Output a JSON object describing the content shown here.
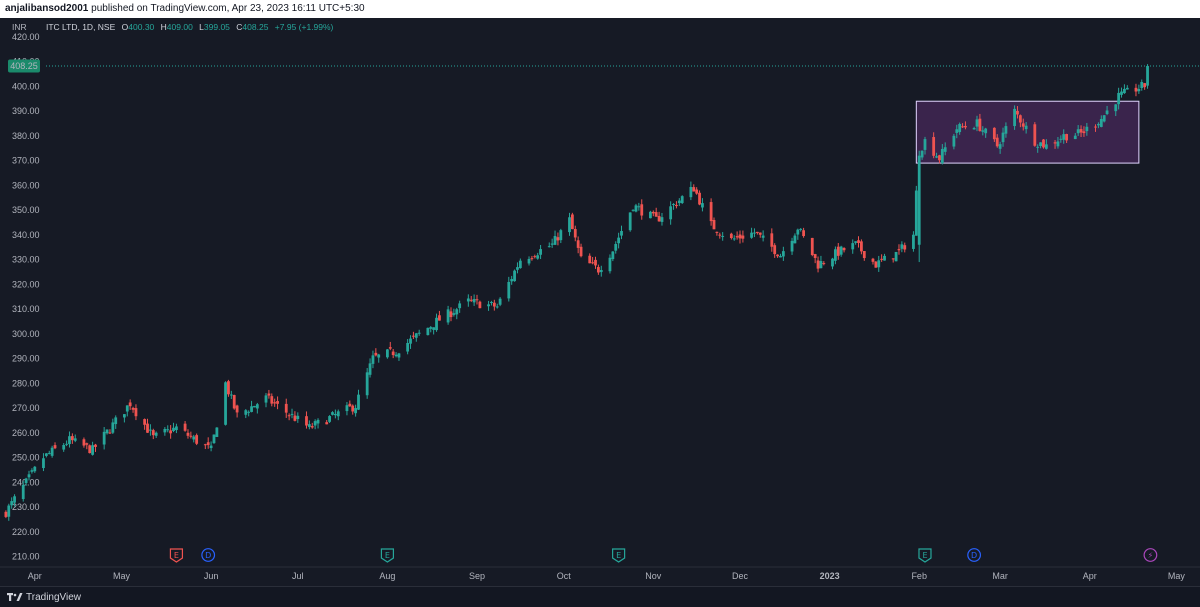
{
  "header": {
    "author": "anjalibansod2001",
    "published_text": "published on TradingView.com, Apr 23, 2023 16:11 UTC+5:30"
  },
  "legend": {
    "symbol": "ITC LTD, 1D, NSE",
    "o_label": "O",
    "o_value": "400.30",
    "h_label": "H",
    "h_value": "409.00",
    "l_label": "L",
    "l_value": "399.05",
    "c_label": "C",
    "c_value": "408.25",
    "change": "+7.95 (+1.99%)",
    "currency": "INR"
  },
  "footer": {
    "brand": "TradingView"
  },
  "colors": {
    "up": "#26a69a",
    "down": "#ef5350",
    "background": "#161a25",
    "box_fill": "#5a2d6e",
    "box_border": "#e0d5ff",
    "price_tag": "#1b8a6b"
  },
  "chart_data": {
    "type": "candlestick",
    "title": "ITC LTD, 1D, NSE",
    "ylabel": "INR",
    "ylim": [
      209,
      424
    ],
    "yticks": [
      "420.00",
      "410.00",
      "400.00",
      "390.00",
      "380.00",
      "370.00",
      "360.00",
      "350.00",
      "340.00",
      "330.00",
      "320.00",
      "310.00",
      "300.00",
      "290.00",
      "280.00",
      "270.00",
      "260.00",
      "250.00",
      "240.00",
      "230.00",
      "220.00",
      "210.00"
    ],
    "x_start": "2022-03-21",
    "x_end": "2023-05-05",
    "xticks": [
      {
        "label": "Apr",
        "date": "2022-04-01"
      },
      {
        "label": "May",
        "date": "2022-05-01"
      },
      {
        "label": "Jun",
        "date": "2022-06-01"
      },
      {
        "label": "Jul",
        "date": "2022-07-01"
      },
      {
        "label": "Aug",
        "date": "2022-08-01"
      },
      {
        "label": "Sep",
        "date": "2022-09-01"
      },
      {
        "label": "Oct",
        "date": "2022-10-01"
      },
      {
        "label": "Nov",
        "date": "2022-11-01"
      },
      {
        "label": "Dec",
        "date": "2022-12-01"
      },
      {
        "label": "2023",
        "date": "2023-01-01"
      },
      {
        "label": "Feb",
        "date": "2023-02-01"
      },
      {
        "label": "Mar",
        "date": "2023-03-01"
      },
      {
        "label": "Apr",
        "date": "2023-04-01"
      },
      {
        "label": "May",
        "date": "2023-05-01"
      }
    ],
    "last_price": "408.25",
    "last_price_value": 408.25,
    "anchors": [
      {
        "date": "2022-03-22",
        "close": 228
      },
      {
        "date": "2022-04-04",
        "close": 250
      },
      {
        "date": "2022-04-13",
        "close": 257
      },
      {
        "date": "2022-04-21",
        "close": 253
      },
      {
        "date": "2022-05-04",
        "close": 272
      },
      {
        "date": "2022-05-12",
        "close": 258
      },
      {
        "date": "2022-05-20",
        "close": 262
      },
      {
        "date": "2022-06-01",
        "close": 253
      },
      {
        "date": "2022-06-06",
        "close": 280
      },
      {
        "date": "2022-06-10",
        "close": 267
      },
      {
        "date": "2022-06-20",
        "close": 274
      },
      {
        "date": "2022-07-05",
        "close": 262
      },
      {
        "date": "2022-07-12",
        "close": 266
      },
      {
        "date": "2022-07-21",
        "close": 271
      },
      {
        "date": "2022-07-27",
        "close": 290
      },
      {
        "date": "2022-08-04",
        "close": 293
      },
      {
        "date": "2022-08-18",
        "close": 305
      },
      {
        "date": "2022-08-29",
        "close": 313
      },
      {
        "date": "2022-09-08",
        "close": 311
      },
      {
        "date": "2022-09-16",
        "close": 330
      },
      {
        "date": "2022-09-27",
        "close": 336
      },
      {
        "date": "2022-10-03",
        "close": 346
      },
      {
        "date": "2022-10-07",
        "close": 330
      },
      {
        "date": "2022-10-13",
        "close": 326
      },
      {
        "date": "2022-10-18",
        "close": 334
      },
      {
        "date": "2022-10-25",
        "close": 352
      },
      {
        "date": "2022-11-02",
        "close": 346
      },
      {
        "date": "2022-11-15",
        "close": 359
      },
      {
        "date": "2022-11-21",
        "close": 344
      },
      {
        "date": "2022-11-28",
        "close": 338
      },
      {
        "date": "2022-12-06",
        "close": 341
      },
      {
        "date": "2022-12-15",
        "close": 332
      },
      {
        "date": "2022-12-21",
        "close": 343
      },
      {
        "date": "2022-12-28",
        "close": 328
      },
      {
        "date": "2023-01-04",
        "close": 333
      },
      {
        "date": "2023-01-10",
        "close": 336
      },
      {
        "date": "2023-01-17",
        "close": 328
      },
      {
        "date": "2023-01-25",
        "close": 333
      },
      {
        "date": "2023-01-30",
        "close": 340
      },
      {
        "date": "2023-02-01",
        "close": 374
      },
      {
        "date": "2023-02-03",
        "close": 378
      },
      {
        "date": "2023-02-08",
        "close": 371
      },
      {
        "date": "2023-02-14",
        "close": 383
      },
      {
        "date": "2023-02-21",
        "close": 385
      },
      {
        "date": "2023-02-28",
        "close": 376
      },
      {
        "date": "2023-03-06",
        "close": 390
      },
      {
        "date": "2023-03-13",
        "close": 378
      },
      {
        "date": "2023-03-17",
        "close": 376
      },
      {
        "date": "2023-03-23",
        "close": 380
      },
      {
        "date": "2023-03-29",
        "close": 381
      },
      {
        "date": "2023-04-05",
        "close": 387
      },
      {
        "date": "2023-04-11",
        "close": 396
      },
      {
        "date": "2023-04-17",
        "close": 399
      },
      {
        "date": "2023-04-20",
        "close": 400.3
      },
      {
        "date": "2023-04-21",
        "close": 408.25
      }
    ],
    "last_candle": {
      "date": "2023-04-21",
      "open": 400.3,
      "high": 409.0,
      "low": 399.05,
      "close": 408.25
    },
    "range_box": {
      "start": "2023-01-31",
      "end": "2023-04-18",
      "low": 369,
      "high": 394
    },
    "event_markers": [
      {
        "date": "2022-05-20",
        "letter": "E",
        "color": "#ef5350"
      },
      {
        "date": "2022-05-31",
        "letter": "D",
        "color": "#2962ff"
      },
      {
        "date": "2022-08-01",
        "letter": "E",
        "color": "#26a69a"
      },
      {
        "date": "2022-10-20",
        "letter": "E",
        "color": "#26a69a"
      },
      {
        "date": "2023-02-03",
        "letter": "E",
        "color": "#26a69a"
      },
      {
        "date": "2023-02-20",
        "letter": "D",
        "color": "#2962ff"
      },
      {
        "date": "2023-04-22",
        "letter": "⚡",
        "color": "#ab47bc"
      }
    ]
  }
}
